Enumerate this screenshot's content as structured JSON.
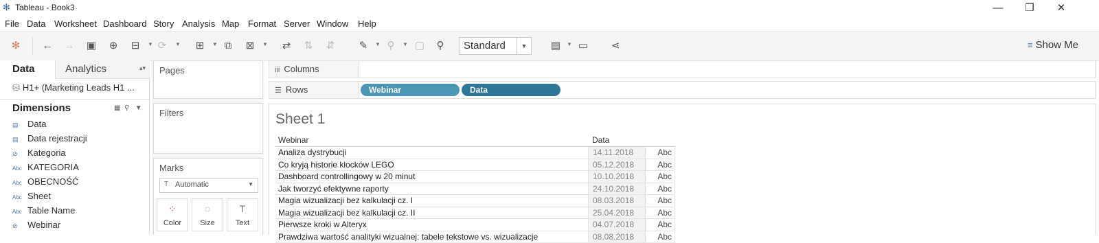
{
  "window": {
    "title": "Tableau - Book3",
    "minimize": "—",
    "restore": "❐",
    "close": "✕"
  },
  "menu": [
    "File",
    "Data",
    "Worksheet",
    "Dashboard",
    "Story",
    "Analysis",
    "Map",
    "Format",
    "Server",
    "Window",
    "Help"
  ],
  "toolbar": {
    "fit_select": "Standard",
    "show_me": "Show Me"
  },
  "datapane": {
    "tabs": {
      "data": "Data",
      "analytics": "Analytics"
    },
    "data_source": "H1+ (Marketing Leads H1 ...",
    "dimensions_title": "Dimensions",
    "fields": [
      {
        "type": "date-icon",
        "label": "Data"
      },
      {
        "type": "date-icon",
        "label": "Data rejestracji"
      },
      {
        "type": "link-icon",
        "label": "Kategoria"
      },
      {
        "type": "abc-icon",
        "label": "KATEGORIA"
      },
      {
        "type": "abc-icon",
        "label": "OBECNOŚĆ"
      },
      {
        "type": "abc-icon",
        "label": "Sheet"
      },
      {
        "type": "abc-icon",
        "label": "Table Name"
      },
      {
        "type": "link-icon",
        "label": "Webinar"
      }
    ]
  },
  "cards": {
    "pages": "Pages",
    "filters": "Filters",
    "marks": "Marks",
    "mark_type": "Automatic",
    "mark_buttons": {
      "color": "Color",
      "size": "Size",
      "text": "Text"
    }
  },
  "shelves": {
    "columns": "Columns",
    "rows": "Rows",
    "row_pills": [
      {
        "label": "Webinar",
        "color": "#4a96b4"
      },
      {
        "label": "Data",
        "color": "#2e7697"
      }
    ]
  },
  "sheet": {
    "title": "Sheet 1",
    "headers": {
      "webinar": "Webinar",
      "data": "Data"
    },
    "rows": [
      {
        "webinar": "Analiza dystrybucji",
        "data": "14.11.2018",
        "value": "Abc"
      },
      {
        "webinar": "Co kryją historie klocków LEGO",
        "data": "05.12.2018",
        "value": "Abc"
      },
      {
        "webinar": "Dashboard controllingowy w 20 minut",
        "data": "10.10.2018",
        "value": "Abc"
      },
      {
        "webinar": "Jak tworzyć efektywne raporty",
        "data": "24.10.2018",
        "value": "Abc"
      },
      {
        "webinar": "Magia wizualizacji bez kalkulacji cz. I",
        "data": "08.03.2018",
        "value": "Abc"
      },
      {
        "webinar": "Magia wizualizacji bez kalkulacji cz. II",
        "data": "25.04.2018",
        "value": "Abc"
      },
      {
        "webinar": "Pierwsze kroki w Alteryx",
        "data": "04.07.2018",
        "value": "Abc"
      },
      {
        "webinar": "Prawdziwa wartość analityki wizualnej: tabele tekstowe vs. wizualizacje",
        "data": "08.08.2018",
        "value": "Abc"
      }
    ]
  }
}
